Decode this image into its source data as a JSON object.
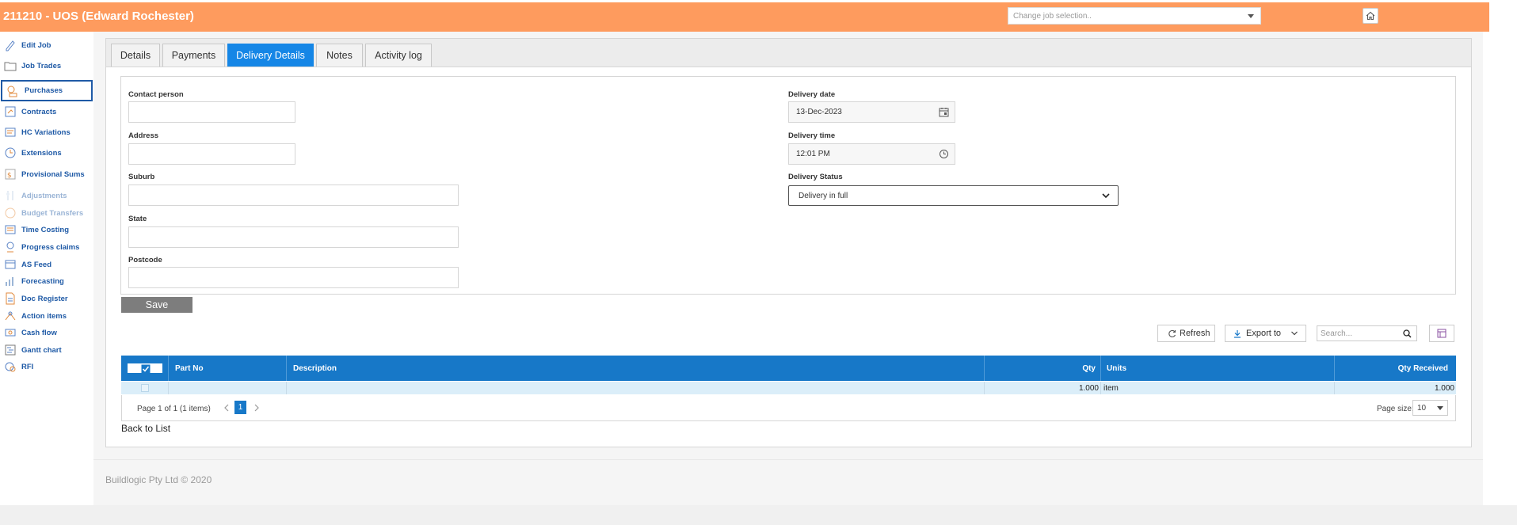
{
  "header": {
    "title": "211210 - UOS (Edward Rochester)",
    "job_select_placeholder": "Change job selection..",
    "home_icon": "home-icon"
  },
  "sidebar": {
    "items": [
      {
        "label": "Edit Job",
        "icon": "pencil-icon"
      },
      {
        "label": "Job Trades",
        "icon": "folder-icon"
      },
      {
        "label": "Purchases",
        "icon": "purchases-icon"
      },
      {
        "label": "Contracts",
        "icon": "contract-icon"
      },
      {
        "label": "HC Variations",
        "icon": "variations-icon"
      },
      {
        "label": "Extensions",
        "icon": "extensions-icon"
      },
      {
        "label": "Provisional Sums",
        "icon": "provisional-icon"
      },
      {
        "label": "Adjustments",
        "icon": "adjustments-icon"
      },
      {
        "label": "Budget Transfers",
        "icon": "budget-icon"
      },
      {
        "label": "Time Costing",
        "icon": "timecost-icon"
      },
      {
        "label": "Progress claims",
        "icon": "progress-icon"
      },
      {
        "label": "AS Feed",
        "icon": "feed-icon"
      },
      {
        "label": "Forecasting",
        "icon": "forecast-icon"
      },
      {
        "label": "Doc Register",
        "icon": "document-icon"
      },
      {
        "label": "Action items",
        "icon": "action-icon"
      },
      {
        "label": "Cash flow",
        "icon": "cashflow-icon"
      },
      {
        "label": "Gantt chart",
        "icon": "gantt-icon"
      },
      {
        "label": "RFI",
        "icon": "rfi-icon"
      }
    ]
  },
  "tabs": [
    {
      "label": "Details"
    },
    {
      "label": "Payments"
    },
    {
      "label": "Delivery Details"
    },
    {
      "label": "Notes"
    },
    {
      "label": "Activity log"
    }
  ],
  "form": {
    "contact_person_label": "Contact person",
    "contact_person_value": "",
    "address_label": "Address",
    "address_value": "",
    "suburb_label": "Suburb",
    "suburb_value": "",
    "state_label": "State",
    "state_value": "",
    "postcode_label": "Postcode",
    "postcode_value": "",
    "delivery_date_label": "Delivery date",
    "delivery_date_value": "13-Dec-2023",
    "delivery_time_label": "Delivery time",
    "delivery_time_value": "12:01 PM",
    "delivery_status_label": "Delivery Status",
    "delivery_status_value": "Delivery in full",
    "save_label": "Save"
  },
  "toolbar": {
    "refresh_label": "Refresh",
    "export_label": "Export to",
    "search_placeholder": "Search..."
  },
  "grid": {
    "columns": [
      "Part No",
      "Description",
      "Qty",
      "Units",
      "Qty Received"
    ],
    "rows": [
      {
        "part_no": "",
        "description": "",
        "qty": "1.000",
        "units": "item",
        "qty_received": "1.000"
      }
    ],
    "pager_text": "Page 1 of 1 (1 items)",
    "current_page": "1",
    "page_size_label": "Page size:",
    "page_size_value": "10"
  },
  "back_label": "Back to List",
  "footer": "Buildlogic Pty Ltd © 2020",
  "colors": {
    "header_bg": "#fe9b5e",
    "active_tab": "#1586e6",
    "grid_header": "#1778c8",
    "sidebar_text": "#1f5aa6"
  }
}
